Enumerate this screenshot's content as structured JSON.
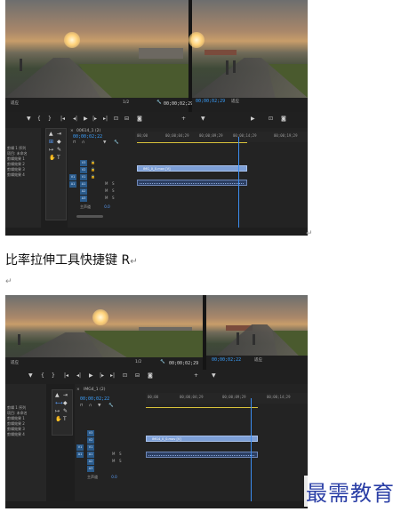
{
  "caption": {
    "text": "比率拉伸工具快捷键 R",
    "return_mark": "↵"
  },
  "paragraph_marks": [
    "↵",
    "↵"
  ],
  "watermark": "最需教育",
  "screenshot1": {
    "source_monitor": {
      "timecode": "00;00;02;29",
      "fit_label": "适应",
      "zoom": "1/2"
    },
    "program_monitor": {
      "timecode": "00;00;02;29",
      "fit_label": "适应",
      "zoom": "1/2"
    },
    "timeline": {
      "tab_label": "00614_1 (2)",
      "timecode": "00;00;02;22",
      "ruler_ticks": [
        "00;00",
        "00;00;04;29",
        "00;00;09;29",
        "00;00;14;29",
        "00;00;19;29"
      ],
      "video_tracks": [
        "V3",
        "V2",
        "V1"
      ],
      "audio_tracks": [
        "A1",
        "A2",
        "A3"
      ],
      "master_label": "主声道",
      "master_value": "0.0",
      "clip_label": "IMG_0_0.mov [V]",
      "playhead_fraction": 0.62
    },
    "side_list": [
      "剪辑 1 序列",
      "项目: 未命名",
      "剪辑效果 1",
      "剪辑效果 2",
      "剪辑效果 3",
      "剪辑效果 4"
    ]
  },
  "screenshot2": {
    "source_monitor": {
      "timecode": "00;00;02;29",
      "fit_label": "适应",
      "zoom": "1/2"
    },
    "program_monitor": {
      "timecode": "00;00;02;22",
      "fit_label": "适应"
    },
    "timeline": {
      "tab_label": "IMG4_1 (2)",
      "timecode": "00;00;02;22",
      "ruler_ticks": [
        "00;00",
        "00;00;04;29",
        "00;00;09;29",
        "00;00;14;29"
      ],
      "video_tracks": [
        "V3",
        "V2",
        "V1"
      ],
      "audio_tracks": [
        "A1",
        "A2",
        "A3"
      ],
      "master_label": "主声道",
      "master_value": "0.0",
      "clip_label": "IMG4_0_0.mov [V]",
      "playhead_fraction": 0.62
    },
    "side_list": [
      "剪辑 1 序列",
      "项目: 未命名",
      "剪辑效果 1",
      "剪辑效果 2",
      "剪辑效果 3",
      "剪辑效果 4"
    ]
  }
}
